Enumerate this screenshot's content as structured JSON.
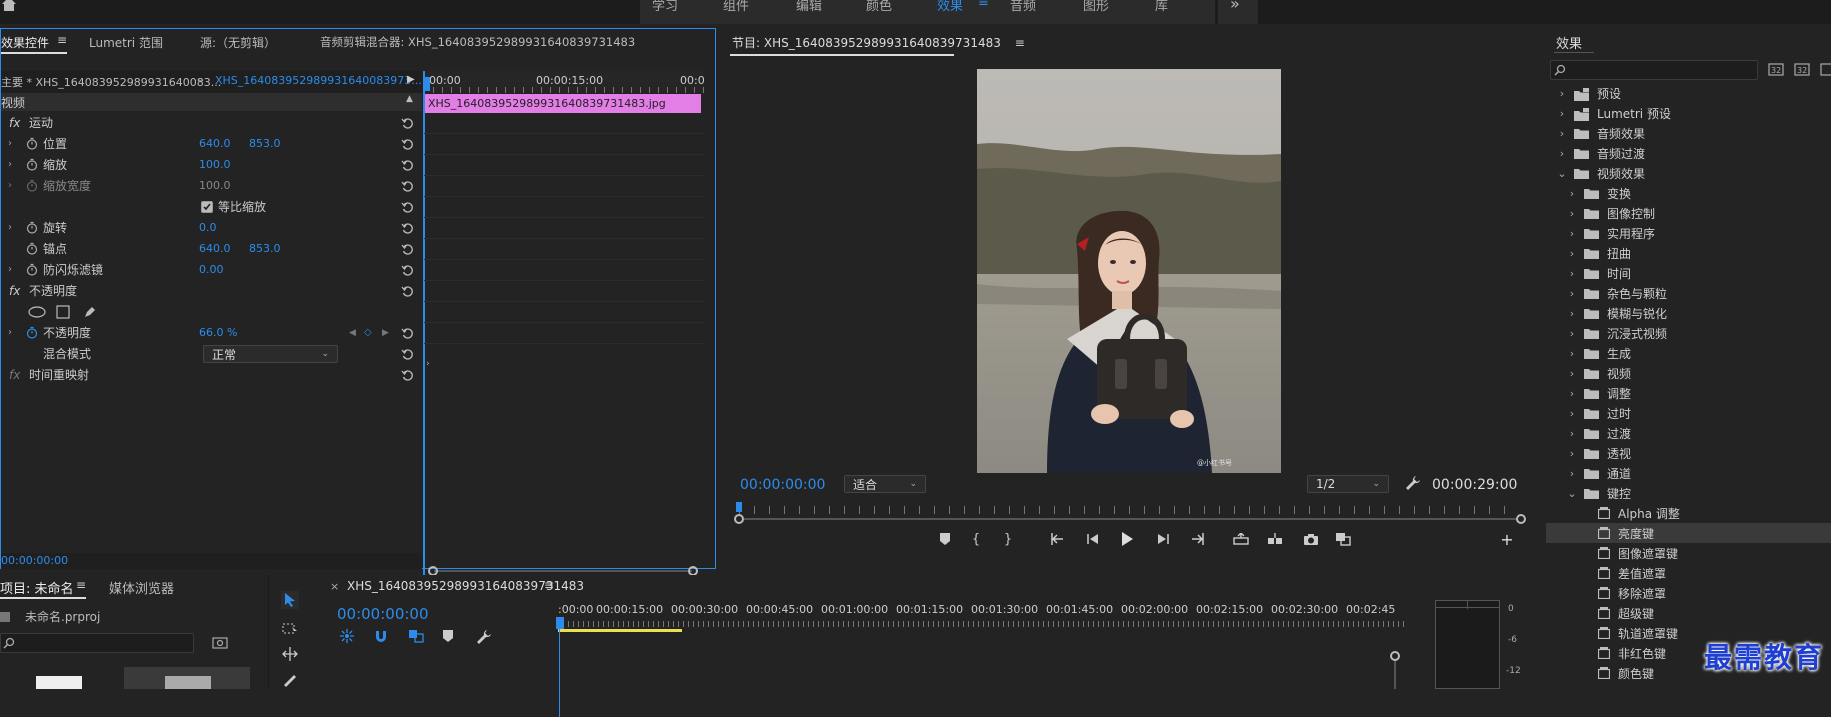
{
  "workspace_tabs": [
    "学习",
    "组件",
    "编辑",
    "颜色",
    "效果",
    "音频",
    "图形",
    "库"
  ],
  "workspace_overflow": "»",
  "effect_controls": {
    "tabs": [
      "效果控件",
      "Lumetri 范围",
      "源:（无剪辑）",
      "音频剪辑混合器: XHS_164083952989931640839731483"
    ],
    "master_label": "主要 * XHS_164083952989931640083...",
    "clip_select": "XHS_164083952989931640083973...",
    "section_video": "视频",
    "motion": "运动",
    "position_label": "位置",
    "position_x": "640.0",
    "position_y": "853.0",
    "scale_label": "缩放",
    "scale": "100.0",
    "scale_width_label": "缩放宽度",
    "scale_width": "100.0",
    "uniform_scale_label": "等比缩放",
    "rotation_label": "旋转",
    "rotation": "0.0",
    "anchor_label": "锚点",
    "anchor_x": "640.0",
    "anchor_y": "853.0",
    "antiflicker_label": "防闪烁滤镜",
    "antiflicker": "0.00",
    "opacity_group": "不透明度",
    "opacity_label": "不透明度",
    "opacity": "66.0 %",
    "blend_label": "混合模式",
    "blend": "正常",
    "time_remap": "时间重映射",
    "fx": "fx",
    "timecode": "00:00:00:00"
  },
  "mini_timeline": {
    "t0": "00:00",
    "t1": "00:00:15:00",
    "t2": "00:0",
    "clip": "XHS_164083952989931640839731483.jpg"
  },
  "program": {
    "title": "节目: XHS_164083952989931640839731483",
    "timecode": "00:00:00:00",
    "fit": "适合",
    "quality": "1/2",
    "duration": "00:00:29:00",
    "watermark": "@小红书号"
  },
  "effects": {
    "title": "效果",
    "search_placeholder": "",
    "items": [
      {
        "label": "预设",
        "level": 0,
        "open": false,
        "kind": "preset"
      },
      {
        "label": "Lumetri 预设",
        "level": 0,
        "open": false,
        "kind": "preset"
      },
      {
        "label": "音频效果",
        "level": 0,
        "open": false,
        "kind": "folder"
      },
      {
        "label": "音频过渡",
        "level": 0,
        "open": false,
        "kind": "folder"
      },
      {
        "label": "视频效果",
        "level": 0,
        "open": true,
        "kind": "folder"
      },
      {
        "label": "变换",
        "level": 1,
        "open": false,
        "kind": "folder"
      },
      {
        "label": "图像控制",
        "level": 1,
        "open": false,
        "kind": "folder"
      },
      {
        "label": "实用程序",
        "level": 1,
        "open": false,
        "kind": "folder"
      },
      {
        "label": "扭曲",
        "level": 1,
        "open": false,
        "kind": "folder"
      },
      {
        "label": "时间",
        "level": 1,
        "open": false,
        "kind": "folder"
      },
      {
        "label": "杂色与颗粒",
        "level": 1,
        "open": false,
        "kind": "folder"
      },
      {
        "label": "模糊与锐化",
        "level": 1,
        "open": false,
        "kind": "folder"
      },
      {
        "label": "沉浸式视频",
        "level": 1,
        "open": false,
        "kind": "folder"
      },
      {
        "label": "生成",
        "level": 1,
        "open": false,
        "kind": "folder"
      },
      {
        "label": "视频",
        "level": 1,
        "open": false,
        "kind": "folder"
      },
      {
        "label": "调整",
        "level": 1,
        "open": false,
        "kind": "folder"
      },
      {
        "label": "过时",
        "level": 1,
        "open": false,
        "kind": "folder"
      },
      {
        "label": "过渡",
        "level": 1,
        "open": false,
        "kind": "folder"
      },
      {
        "label": "透视",
        "level": 1,
        "open": false,
        "kind": "folder"
      },
      {
        "label": "通道",
        "level": 1,
        "open": false,
        "kind": "folder"
      },
      {
        "label": "键控",
        "level": 1,
        "open": true,
        "kind": "folder"
      },
      {
        "label": "Alpha 调整",
        "level": 2,
        "kind": "effect"
      },
      {
        "label": "亮度键",
        "level": 2,
        "kind": "effect",
        "selected": true
      },
      {
        "label": "图像遮罩键",
        "level": 2,
        "kind": "effect"
      },
      {
        "label": "差值遮罩",
        "level": 2,
        "kind": "effect"
      },
      {
        "label": "移除遮罩",
        "level": 2,
        "kind": "effect"
      },
      {
        "label": "超级键",
        "level": 2,
        "kind": "effect"
      },
      {
        "label": "轨道遮罩键",
        "level": 2,
        "kind": "effect"
      },
      {
        "label": "非红色键",
        "level": 2,
        "kind": "effect"
      },
      {
        "label": "颜色键",
        "level": 2,
        "kind": "effect"
      }
    ]
  },
  "project": {
    "tabs": [
      "项目: 未命名",
      "媒体浏览器"
    ],
    "file": "未命名.prproj"
  },
  "timeline": {
    "seq_name": "XHS_164083952989931640839731483",
    "timecode": "00:00:00:00",
    "ticks": [
      ":00:00",
      "00:00:15:00",
      "00:00:30:00",
      "00:00:45:00",
      "00:01:00:00",
      "00:01:15:00",
      "00:01:30:00",
      "00:01:45:00",
      "00:02:00:00",
      "00:02:15:00",
      "00:02:30:00",
      "00:02:45"
    ]
  },
  "meter": {
    "labels": [
      "0",
      "-6",
      "-12"
    ]
  },
  "brand": "最需教育",
  "colors": {
    "accent": "#2d8ceb",
    "clip": "#e27ee6",
    "bg": "#232323"
  }
}
